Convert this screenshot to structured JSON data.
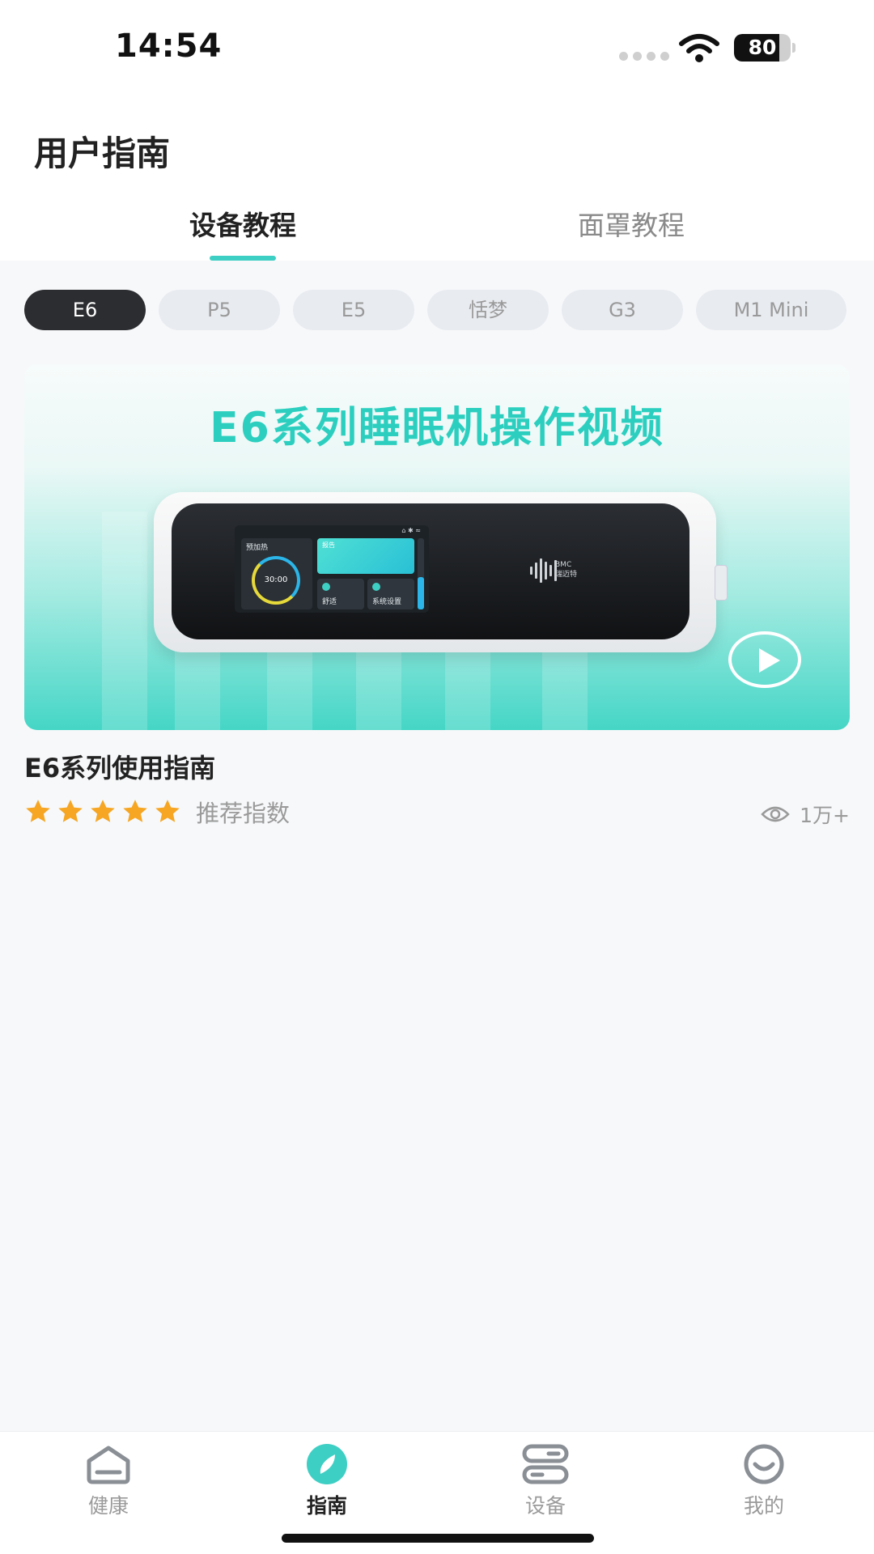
{
  "status_bar": {
    "time": "14:54",
    "battery_percent": 80,
    "battery_text": "80"
  },
  "header": {
    "title": "用户指南",
    "tabs": [
      {
        "label": "设备教程",
        "active": true
      },
      {
        "label": "面罩教程",
        "active": false
      }
    ]
  },
  "models": {
    "items": [
      {
        "label": "E6",
        "active": true
      },
      {
        "label": "P5",
        "active": false
      },
      {
        "label": "E5",
        "active": false
      },
      {
        "label": "恬梦",
        "active": false
      },
      {
        "label": "G3",
        "active": false
      },
      {
        "label": "M1 Mini",
        "active": false
      }
    ]
  },
  "video_card": {
    "headline": "E6系列睡眠机操作视频",
    "screen": {
      "preheat_label": "预加热",
      "timer": "30:00",
      "tile_top_label": "报告",
      "tile_comfort_label": "舒适",
      "tile_settings_label": "系统设置"
    },
    "logo_text_line1": "BMC",
    "logo_text_line2": "瑞迈特",
    "title": "E6系列使用指南",
    "rating": 5,
    "rating_label": "推荐指数",
    "views": "1万+"
  },
  "bottom_nav": {
    "items": [
      {
        "label": "健康",
        "icon": "health-icon",
        "active": false
      },
      {
        "label": "指南",
        "icon": "compass-icon",
        "active": true
      },
      {
        "label": "设备",
        "icon": "device-icon",
        "active": false
      },
      {
        "label": "我的",
        "icon": "smile-icon",
        "active": false
      }
    ]
  },
  "colors": {
    "accent": "#3ecfc4",
    "star": "#f6a623",
    "chip_active": "#2c2d30"
  }
}
